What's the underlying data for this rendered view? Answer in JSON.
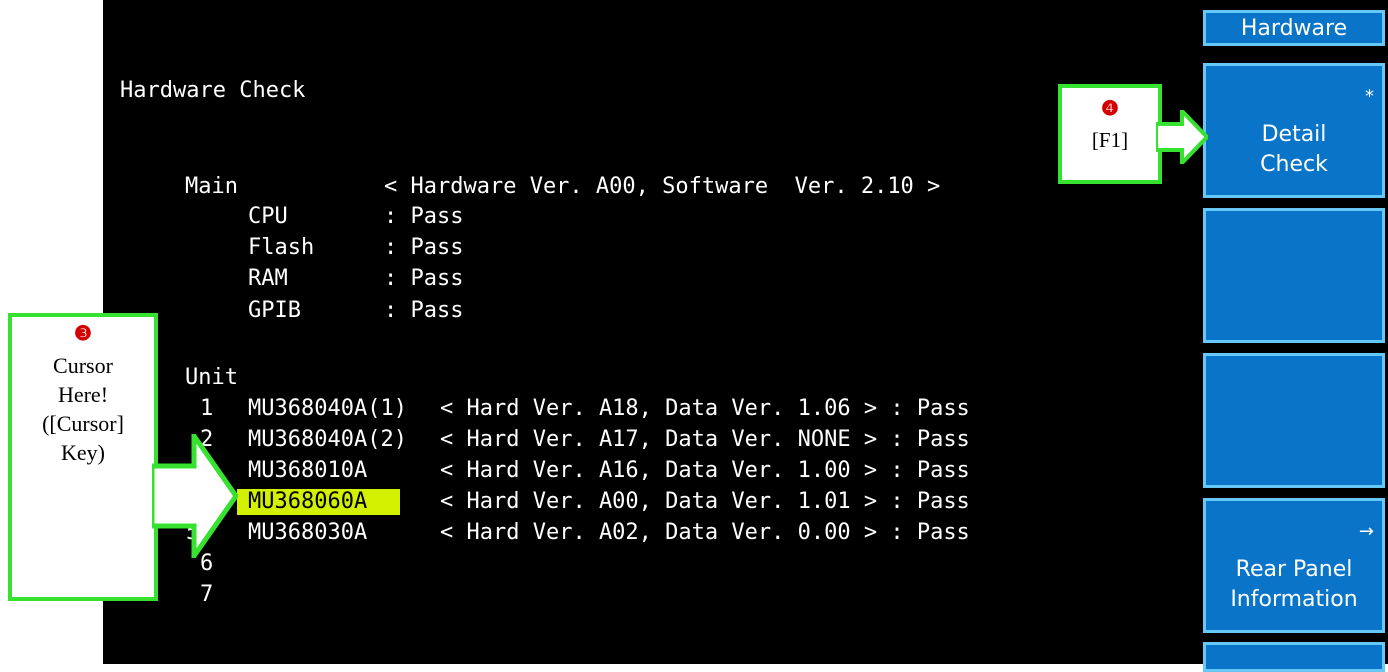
{
  "softkeys": {
    "header": "Hardware",
    "f1": {
      "line1": "Detail",
      "line2": "Check",
      "corner": "*"
    },
    "f5": {
      "line1": "Rear Panel",
      "line2": "Information",
      "corner": "→"
    }
  },
  "title": "Hardware Check",
  "main": {
    "label": "Main",
    "version": "< Hardware Ver. A00, Software  Ver. 2.10 >",
    "items": [
      {
        "name": "CPU",
        "status": ": Pass"
      },
      {
        "name": "Flash",
        "status": ": Pass"
      },
      {
        "name": "RAM",
        "status": ": Pass"
      },
      {
        "name": "GPIB",
        "status": ": Pass"
      }
    ]
  },
  "unit": {
    "label": "Unit",
    "rows": [
      {
        "num": "1",
        "model": "MU368040A(1)",
        "version": "< Hard Ver. A18, Data Ver. 1.06 > : Pass"
      },
      {
        "num": "2",
        "model": "MU368040A(2)",
        "version": "< Hard Ver. A17, Data Ver. NONE > : Pass"
      },
      {
        "num": "",
        "model": "MU368010A",
        "version": "< Hard Ver. A16, Data Ver. 1.00 > : Pass"
      },
      {
        "num": "",
        "model": "MU368060A",
        "version": "< Hard Ver. A00, Data Ver. 1.01 > : Pass"
      },
      {
        "num": "5",
        "model": "MU368030A",
        "version": "< Hard Ver. A02, Data Ver. 0.00 > : Pass"
      },
      {
        "num": "6",
        "model": "",
        "version": ""
      },
      {
        "num": "7",
        "model": "",
        "version": ""
      }
    ]
  },
  "callouts": {
    "step4": {
      "num": "❹",
      "text": "[F1]"
    },
    "step3": {
      "num": "❸",
      "line1": "Cursor",
      "line2": "Here!",
      "line3": "([Cursor]",
      "line4": "Key)"
    }
  },
  "colors": {
    "screen_bg": "#000000",
    "softkey_bg": "#0a74c8",
    "softkey_border": "#67c8f8",
    "cursor_highlight": "#d2f000",
    "callout_green": "#36e22f",
    "callout_number_red": "#d40000"
  }
}
